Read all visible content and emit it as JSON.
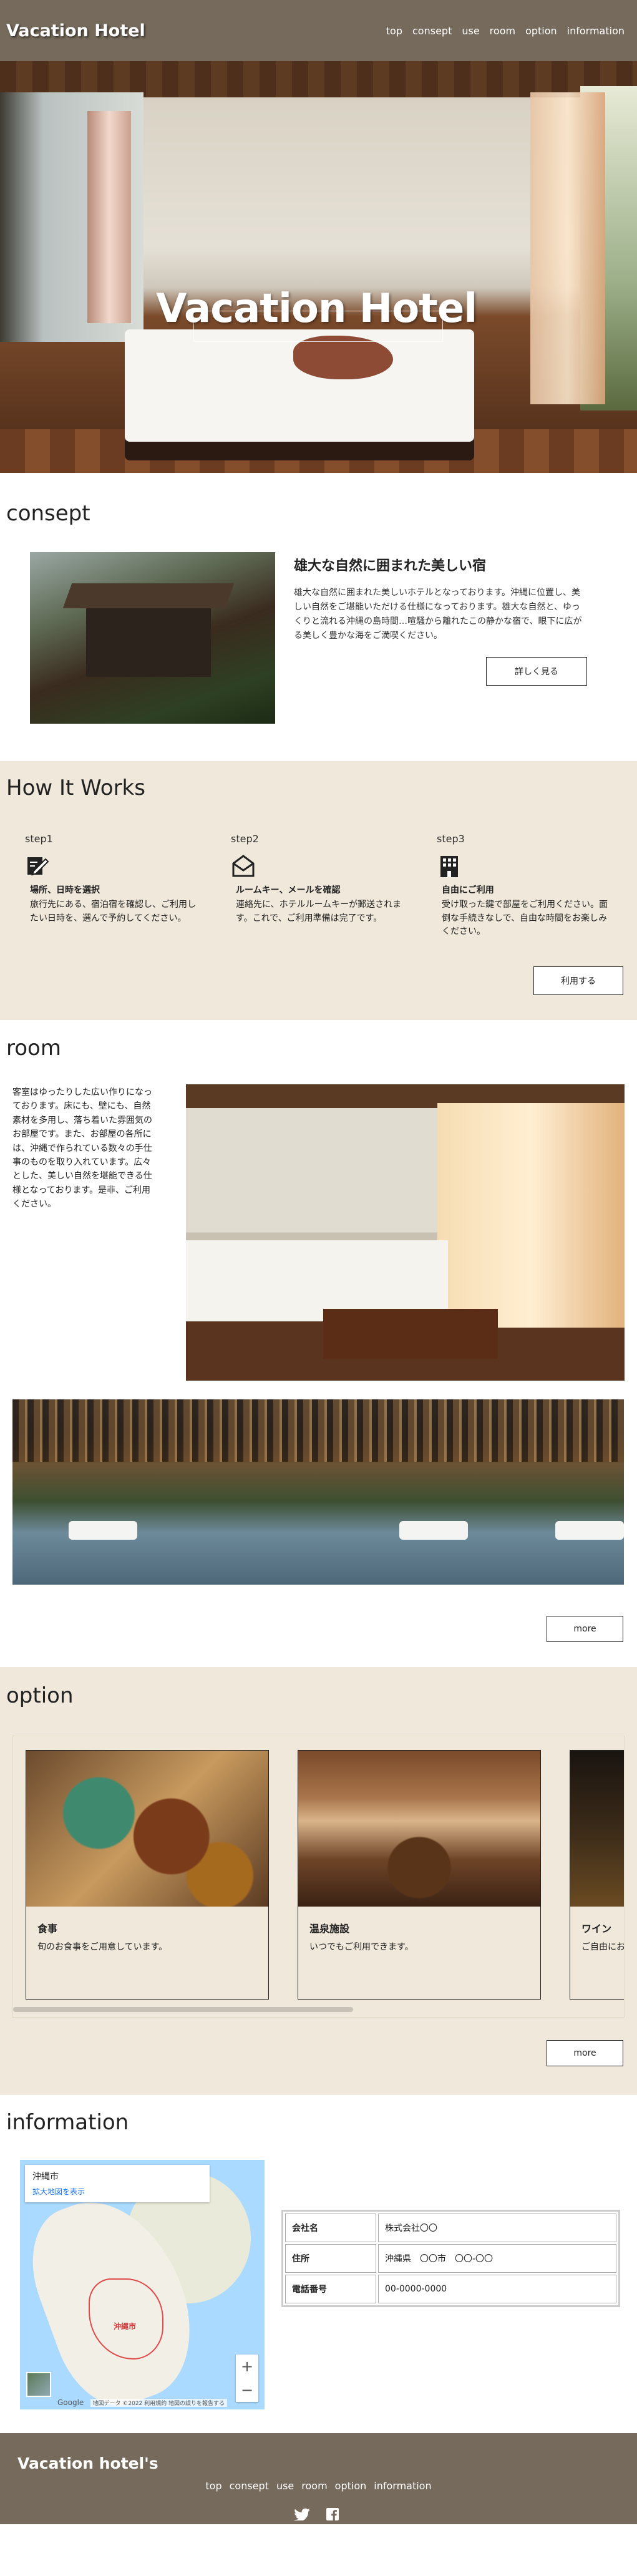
{
  "header": {
    "logo": "Vacation Hotel",
    "nav": [
      "top",
      "consept",
      "use",
      "room",
      "option",
      "information"
    ]
  },
  "hero": {
    "title": "Vacation Hotel"
  },
  "consept": {
    "title": "consept",
    "heading": "雄大な自然に囲まれた美しい宿",
    "body": "雄大な自然に囲まれた美しいホテルとなっております。沖縄に位置し、美しい自然をご堪能いただける仕様になっております。雄大な自然と、ゆっくりと流れる沖縄の島時間…喧騒から離れたこの静かな宿で、眼下に広がる美しく豊かな海をご満喫ください。",
    "button": "詳しく見る"
  },
  "how": {
    "title": "How It Works",
    "steps": [
      {
        "label": "step1",
        "icon": "write-icon",
        "head": "場所、日時を選択",
        "desc": "旅行先にある、宿泊宿を確認し、ご利用したい日時を、選んで予約してください。"
      },
      {
        "label": "step2",
        "icon": "mail-icon",
        "head": "ルームキー、メールを確認",
        "desc": "連絡先に、ホテルルームキーが郵送されます。これで、ご利用準備は完了です。"
      },
      {
        "label": "step3",
        "icon": "building-icon",
        "head": "自由にご利用",
        "desc": "受け取った鍵で部屋をご利用ください。面倒な手続きなしで、自由な時間をお楽しみください。"
      }
    ],
    "button": "利用する"
  },
  "room": {
    "title": "room",
    "body": "客室はゆったりした広い作りになっております。床にも、壁にも、自然素材を多用し、落ち着いた雰囲気のお部屋です。また、お部屋の各所には、沖縄で作られている数々の手仕事のものを取り入れています。広々とした、美しい自然を堪能できる仕様となっております。是非、ご利用ください。",
    "button": "more"
  },
  "option": {
    "title": "option",
    "cards": [
      {
        "title": "食事",
        "desc": "旬のお食事をご用意しています。",
        "img": "food"
      },
      {
        "title": "温泉施設",
        "desc": "いつでもご利用できます。",
        "img": "onsen"
      },
      {
        "title": "ワイン",
        "desc": "ご自由にお楽しみください。",
        "img": "wine"
      }
    ],
    "button": "more"
  },
  "information": {
    "title": "information",
    "map": {
      "place": "沖縄市",
      "link": "拡大地図を表示",
      "city_label": "沖縄市",
      "brand": "Google",
      "terms": "地図データ ©2022 利用規約 地図の誤りを報告する",
      "zoom_in": "+",
      "zoom_out": "−"
    },
    "table": [
      {
        "label": "会社名",
        "value": "株式会社〇〇"
      },
      {
        "label": "住所",
        "value": "沖縄県　〇〇市　〇〇-〇〇"
      },
      {
        "label": "電話番号",
        "value": "00-0000-0000"
      }
    ]
  },
  "footer": {
    "logo": "Vacation hotel's",
    "nav": [
      "top",
      "consept",
      "use",
      "room",
      "option",
      "information"
    ],
    "social": [
      "twitter-icon",
      "facebook-icon"
    ]
  }
}
